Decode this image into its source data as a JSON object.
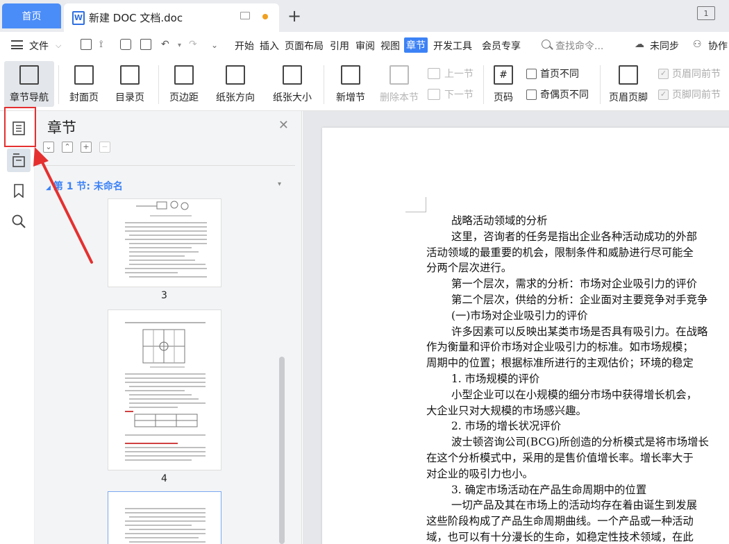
{
  "tabs": {
    "home": "首页",
    "doc": "新建 DOC 文档.doc",
    "doc_icon": "W",
    "add": "+",
    "window_indicator": "1"
  },
  "menu": {
    "file": "文件",
    "items": [
      "开始",
      "插入",
      "页面布局",
      "引用",
      "审阅",
      "视图",
      "章节",
      "开发工具",
      "会员专享"
    ],
    "active": "章节",
    "search": "查找命令...",
    "sync": "未同步",
    "collab": "协作"
  },
  "ribbon": {
    "chapter_nav": "章节导航",
    "cover": "封面页",
    "toc": "目录页",
    "margin": "页边距",
    "orientation": "纸张方向",
    "size": "纸张大小",
    "new_section": "新增节",
    "delete_section": "删除本节",
    "prev_section": "上一节",
    "next_section": "下一节",
    "page_number": "页码",
    "first_page_diff": "首页不同",
    "odd_even_diff": "奇偶页不同",
    "header_footer": "页眉页脚",
    "header_same": "页眉同前节",
    "footer_same": "页脚同前节"
  },
  "panel": {
    "title": "章节",
    "section": "第 1 节: 未命名",
    "pages": [
      "3",
      "4"
    ]
  },
  "document": {
    "lines": [
      {
        "text": "战略活动领域的分析",
        "indent": true
      },
      {
        "text": "这里，咨询者的任务是指出企业各种活动成功的外部",
        "indent": true
      },
      {
        "text": "活动领域的最重要的机会，限制条件和威胁进行尽可能全",
        "indent": false
      },
      {
        "text": "分两个层次进行。",
        "indent": false
      },
      {
        "text": "第一个层次，需求的分析：市场对企业吸引力的评价",
        "indent": true
      },
      {
        "text": "第二个层次，供给的分析：企业面对主要竞争对手竞争",
        "indent": true
      },
      {
        "text": "(一)市场对企业吸引力的评价",
        "indent": true
      },
      {
        "text": "许多因素可以反映出某类市场是否具有吸引力。在战略",
        "indent": true
      },
      {
        "text": "作为衡量和评价市场对企业吸引力的标准。如市场规模；",
        "indent": false
      },
      {
        "text": "周期中的位置；根据标准所进行的主观估价；环境的稳定",
        "indent": false
      },
      {
        "text": "1. 市场规模的评价",
        "indent": true
      },
      {
        "text": "小型企业可以在小规模的细分市场中获得增长机会，",
        "indent": true
      },
      {
        "text": "大企业只对大规模的市场感兴趣。",
        "indent": false
      },
      {
        "text": "2. 市场的增长状况评价",
        "indent": true
      },
      {
        "text": "波士顿咨询公司(BCG)所创造的分析模式是将市场增长",
        "indent": true
      },
      {
        "text": "在这个分析模式中，采用的是售价值增长率。增长率大于",
        "indent": false
      },
      {
        "text": "对企业的吸引力也小。",
        "indent": false
      },
      {
        "text": "3. 确定市场活动在产品生命周期中的位置",
        "indent": true
      },
      {
        "text": "一切产品及其在市场上的活动均存在着由诞生到发展",
        "indent": true
      },
      {
        "text": "这些阶段构成了产品生命周期曲线。一个产品或一种活动",
        "indent": false
      },
      {
        "text": "域，也可以有十分漫长的生命，如稳定性技术领域，在此",
        "indent": false
      }
    ]
  },
  "colors": {
    "accent": "#3c82f6",
    "highlight_box": "#e53030"
  }
}
